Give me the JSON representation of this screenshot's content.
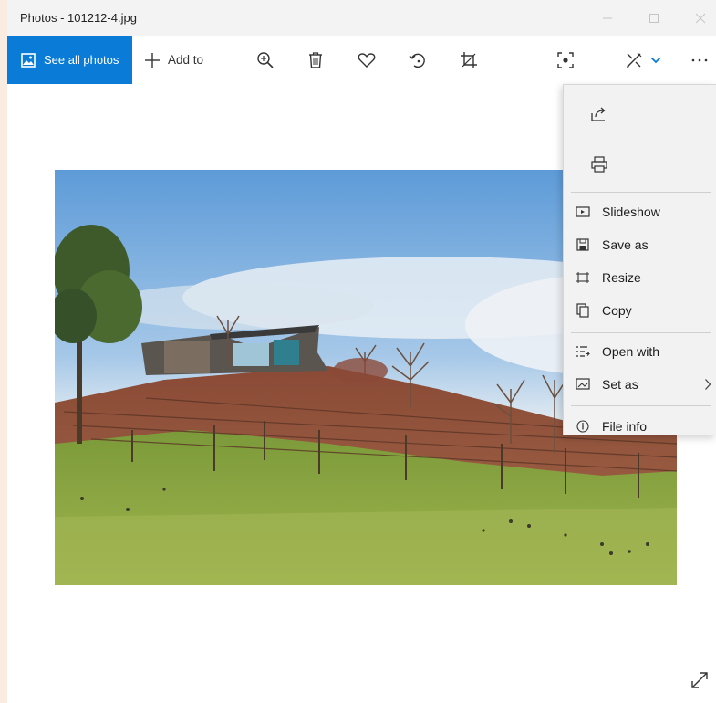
{
  "window": {
    "title": "Photos - 101212-4.jpg"
  },
  "toolbar": {
    "see_all_label": "See all photos",
    "add_to_label": "Add to",
    "accent_color": "#0a7bd6"
  },
  "menu": {
    "items": [
      {
        "label": "Slideshow",
        "icon": "slideshow-icon"
      },
      {
        "label": "Save as",
        "icon": "save-icon"
      },
      {
        "label": "Resize",
        "icon": "resize-icon"
      },
      {
        "label": "Copy",
        "icon": "copy-icon"
      },
      {
        "label": "Open with",
        "icon": "open-with-icon"
      },
      {
        "label": "Set as",
        "icon": "set-as-icon"
      },
      {
        "label": "File info",
        "icon": "info-icon"
      }
    ]
  }
}
